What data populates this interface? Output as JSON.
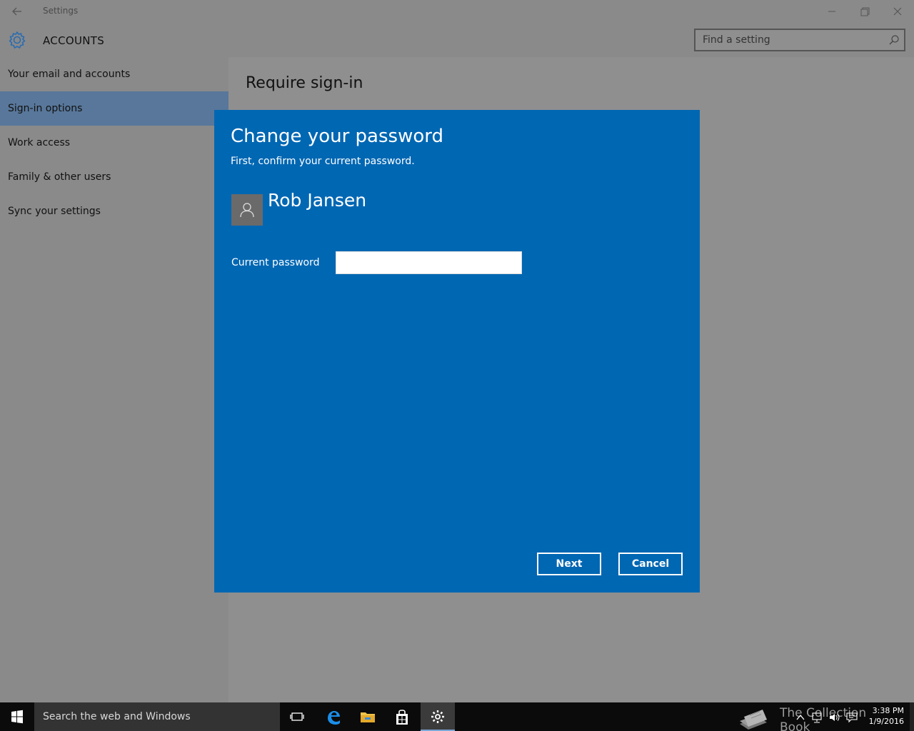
{
  "window": {
    "title": "Settings"
  },
  "header": {
    "section": "ACCOUNTS",
    "search_placeholder": "Find a setting"
  },
  "sidebar": {
    "items": [
      {
        "label": "Your email and accounts",
        "active": false
      },
      {
        "label": "Sign-in options",
        "active": true
      },
      {
        "label": "Work access",
        "active": false
      },
      {
        "label": "Family & other users",
        "active": false
      },
      {
        "label": "Sync your settings",
        "active": false
      }
    ]
  },
  "content": {
    "heading": "Require sign-in"
  },
  "dialog": {
    "title": "Change your password",
    "subtitle": "First, confirm your current password.",
    "user_name": "Rob Jansen",
    "password_label": "Current password",
    "password_value": "",
    "next_label": "Next",
    "cancel_label": "Cancel"
  },
  "taskbar": {
    "search_text": "Search the web and Windows",
    "watermark": "The Collection Book",
    "time": "3:38 PM",
    "date": "1/9/2016"
  },
  "colors": {
    "dialog_bg": "#0067b3",
    "sidebar_active": "#58779a",
    "background": "#8a8a8a",
    "taskbar": "#0b0b0b"
  }
}
